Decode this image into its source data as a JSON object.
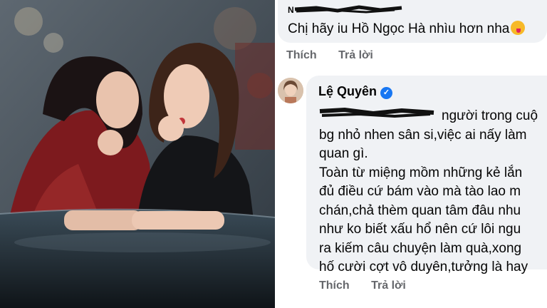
{
  "photo": {
    "description_icon": "photo-icon"
  },
  "comment1": {
    "author_redacted": "N",
    "text": "Chị hãy iu Hồ Ngọc Hà nhìu hơn nha",
    "emoji": "laughing-face-icon"
  },
  "comment1_actions": {
    "like": "Thích",
    "reply": "Trả lời"
  },
  "comment2": {
    "author": "Lệ Quyên",
    "verified_icon": "verified-badge-icon",
    "lines": [
      "người trong cuộ",
      "bg nhỏ nhen sân si,việc ai nấy làm",
      "quan gì.",
      "Toàn từ miệng mồm những kẻ lắn",
      "đủ điều cứ bám vào mà tào lao m",
      "chán,chả thèm quan tâm đâu nhu",
      "như ko biết xấu hổ nên cứ lôi ngu",
      "ra kiếm câu chuyện làm quà,xong",
      "hố cười cợt vô duyên,tưởng là hay"
    ]
  },
  "comment2_actions": {
    "like": "Thích",
    "reply": "Trả lời"
  },
  "colors": {
    "bubble": "#f0f2f5",
    "action": "#65676b",
    "verified": "#1877f2"
  }
}
